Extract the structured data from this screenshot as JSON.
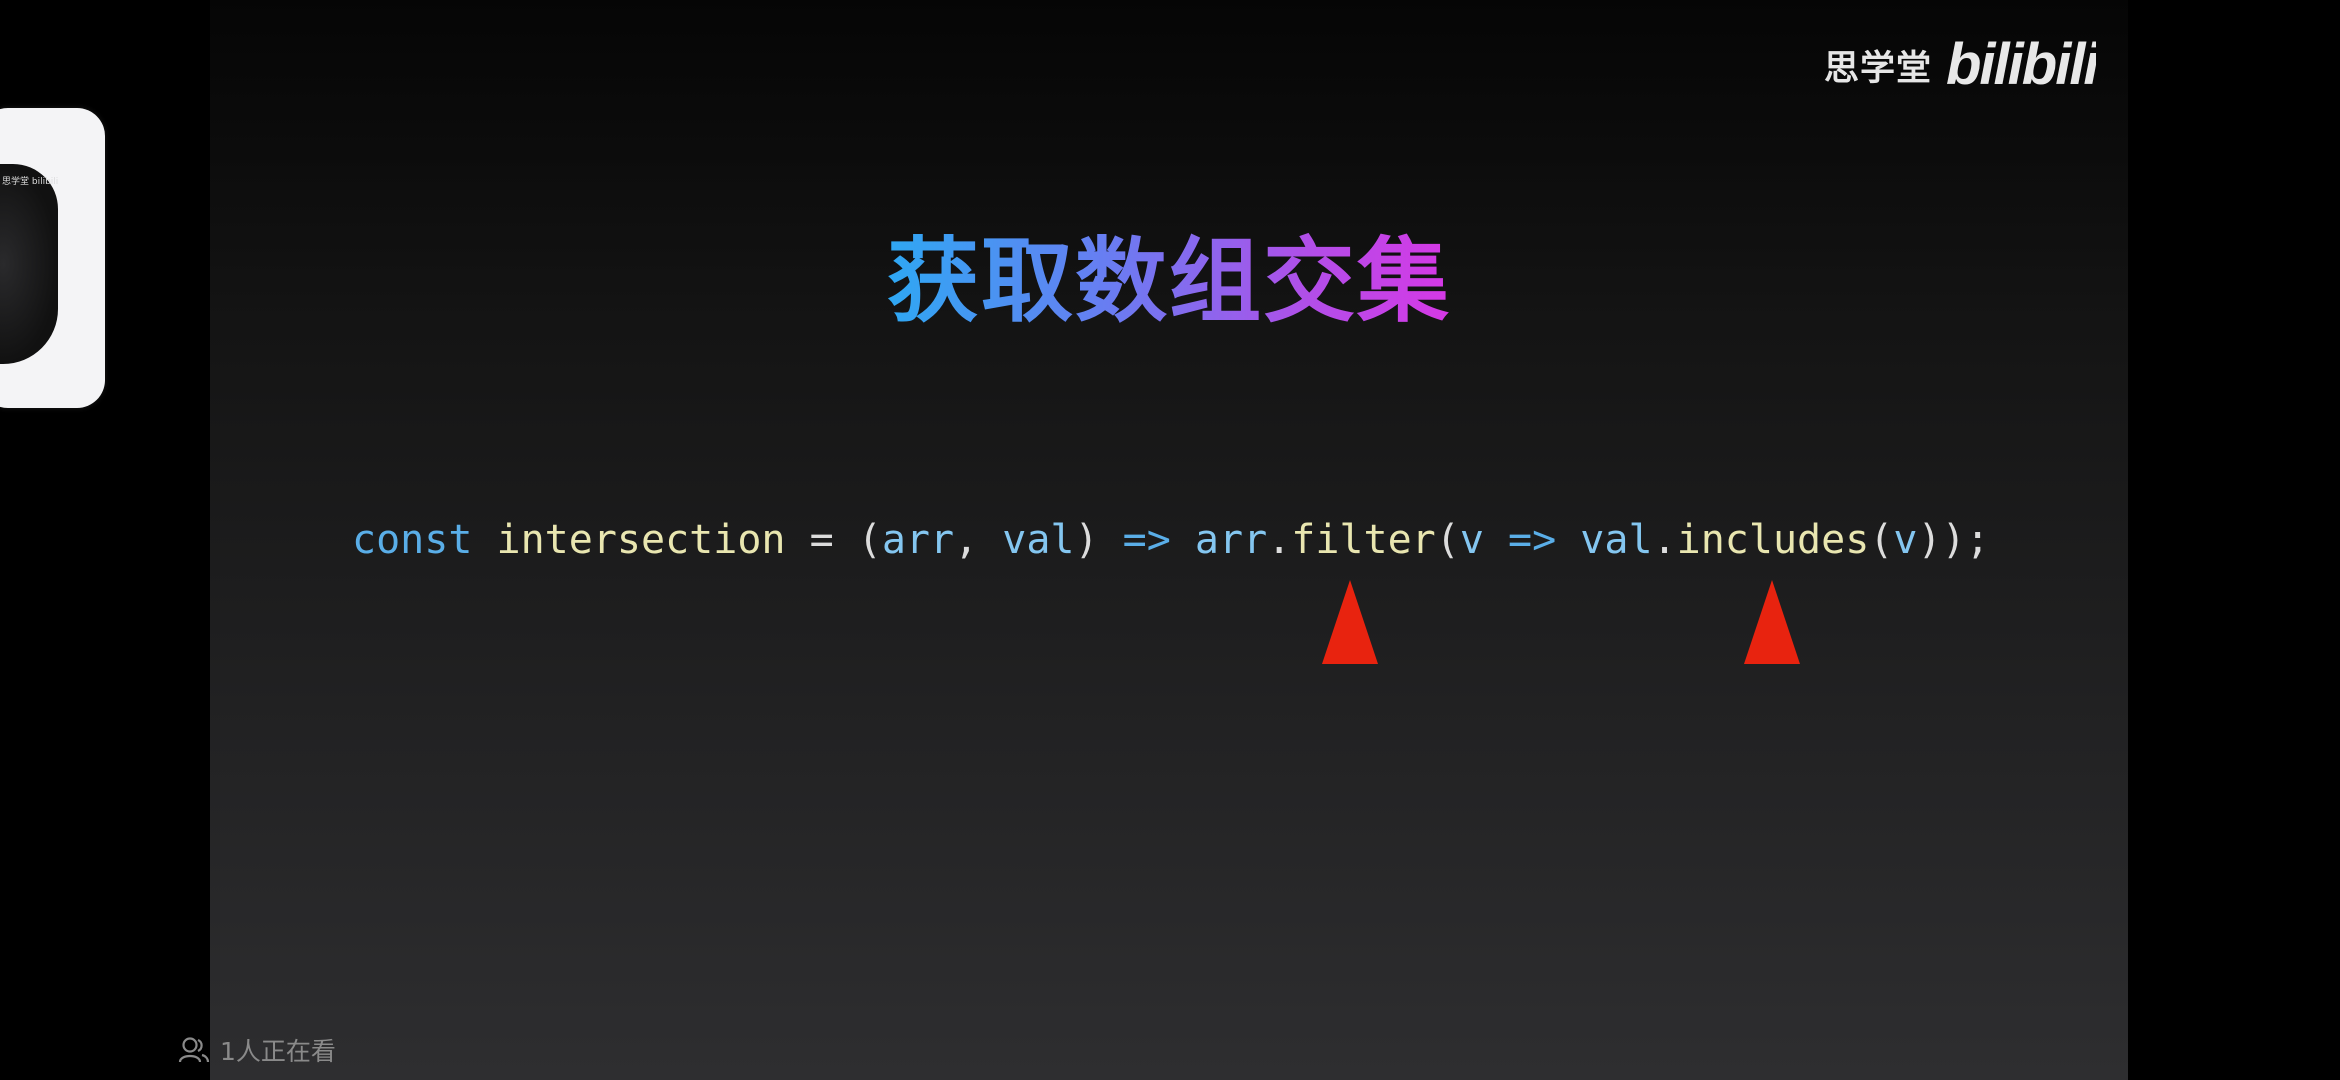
{
  "watermark": {
    "school": "思学堂",
    "brand": "bilibili"
  },
  "slide": {
    "title": "获取数组交集",
    "code": {
      "kw_const": "const",
      "fn_name": "intersection",
      "eq": " = (",
      "p_arr": "arr",
      "comma": ", ",
      "p_val": "val",
      "close_paren": ") ",
      "arrow1": "=>",
      "body_arr": " arr",
      "dot1": ".",
      "m_filter": "filter",
      "open1": "(",
      "v1": "v",
      "sp": " ",
      "arrow2": "=>",
      "body_val": " val",
      "dot2": ".",
      "m_includes": "includes",
      "open2": "(",
      "v2": "v",
      "tail": "));"
    },
    "marker_color": "#e8230f"
  },
  "pip": {
    "caption": "思学堂 bilibili"
  },
  "viewers": {
    "text": "1人正在看",
    "icon": "viewers-icon"
  },
  "colors": {
    "title_gradient_start": "#2ea8f3",
    "title_gradient_end": "#d638e6",
    "keyword": "#5aaee8",
    "function_name": "#e9e6b0"
  }
}
